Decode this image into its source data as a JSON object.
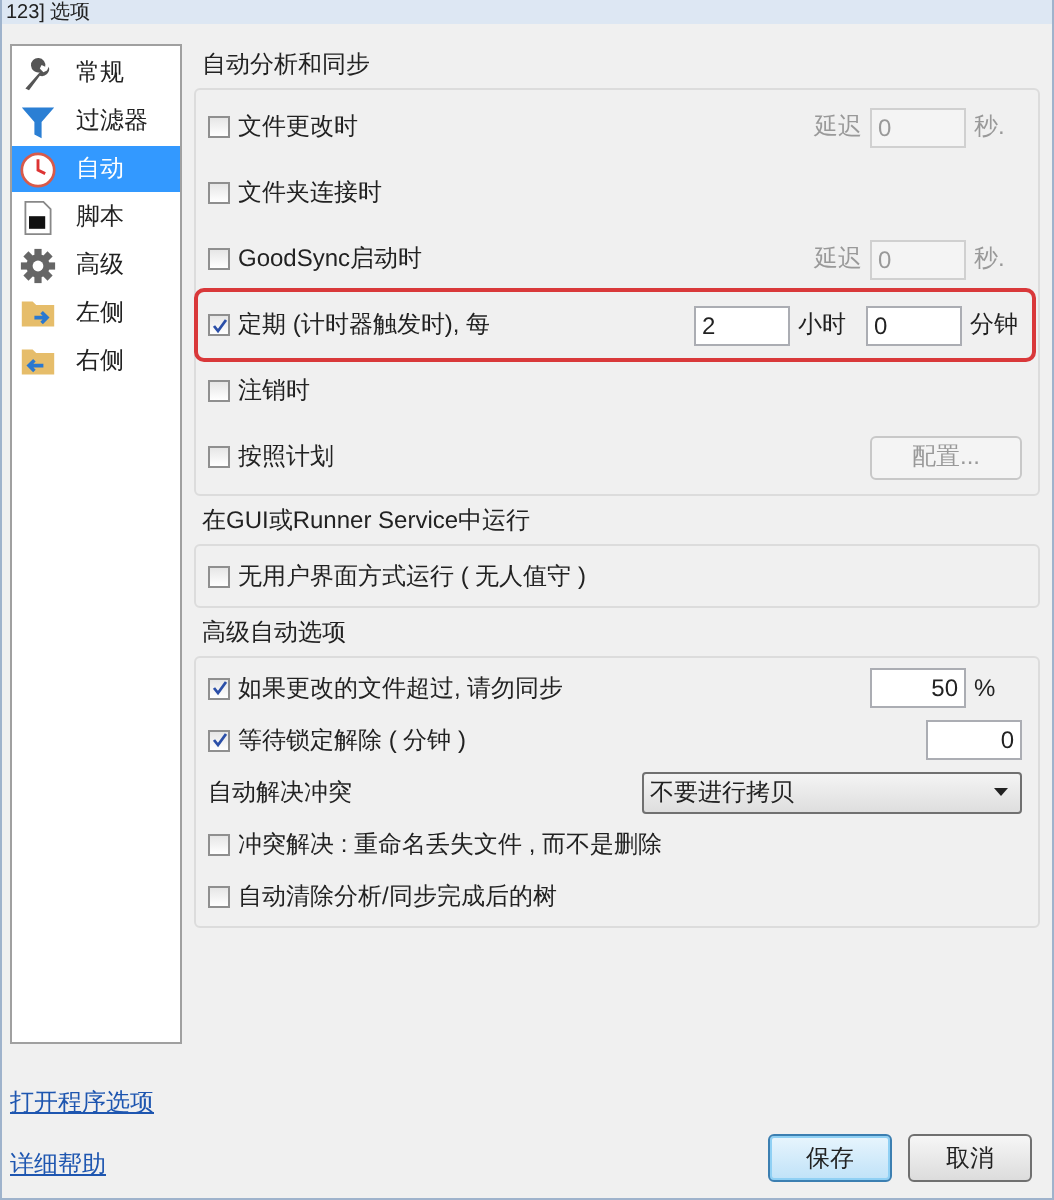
{
  "window": {
    "title": "123] 选项"
  },
  "sidebar": {
    "items": [
      {
        "label": "常规",
        "kind": "wrench",
        "selected": false
      },
      {
        "label": "过滤器",
        "kind": "filter",
        "selected": false
      },
      {
        "label": "自动",
        "kind": "clock",
        "selected": true
      },
      {
        "label": "脚本",
        "kind": "script",
        "selected": false
      },
      {
        "label": "高级",
        "kind": "gear",
        "selected": false
      },
      {
        "label": "左侧",
        "kind": "folder-right",
        "selected": false
      },
      {
        "label": "右侧",
        "kind": "folder-left",
        "selected": false
      }
    ]
  },
  "groups": [
    {
      "title": "自动分析和同步",
      "rows": [
        {
          "kind": "check",
          "label": "文件更改时",
          "checked": false,
          "highlighted": false,
          "fields": [
            {
              "prefix": "延迟",
              "value": "0",
              "suffix": "秒.",
              "disabled": true
            }
          ]
        },
        {
          "kind": "check",
          "label": "文件夹连接时",
          "checked": false,
          "highlighted": false
        },
        {
          "kind": "check",
          "label": "GoodSync启动时",
          "checked": false,
          "highlighted": false,
          "fields": [
            {
              "prefix": "延迟",
              "value": "0",
              "suffix": "秒.",
              "disabled": true
            }
          ]
        },
        {
          "kind": "check",
          "label": "定期 (计时器触发时), 每",
          "checked": true,
          "highlighted": true,
          "fields": [
            {
              "value": "2",
              "suffix": "小时",
              "disabled": false
            },
            {
              "value": "0",
              "suffix": "分钟",
              "disabled": false
            }
          ]
        },
        {
          "kind": "check",
          "label": "注销时",
          "checked": false,
          "highlighted": false
        },
        {
          "kind": "check",
          "label": "按照计划",
          "checked": false,
          "highlighted": false,
          "button": {
            "label": "配置...",
            "disabled": true
          }
        }
      ]
    },
    {
      "title": "在GUI或Runner Service中运行",
      "rows": [
        {
          "kind": "check",
          "label": "无用户界面方式运行 ( 无人值守 )",
          "checked": false,
          "highlighted": false
        }
      ]
    },
    {
      "title": "高级自动选项",
      "rows": [
        {
          "kind": "check",
          "label": "如果更改的文件超过, 请勿同步",
          "checked": true,
          "highlighted": false,
          "fields": [
            {
              "value": "50",
              "suffix": "%",
              "disabled": false
            }
          ]
        },
        {
          "kind": "check",
          "label": "等待锁定解除 ( 分钟 )",
          "checked": true,
          "highlighted": false,
          "fields": [
            {
              "value": "0",
              "disabled": false
            }
          ]
        },
        {
          "kind": "select",
          "label": "自动解决冲突",
          "value": "不要进行拷贝"
        },
        {
          "kind": "check",
          "label": "冲突解决 : 重命名丢失文件 , 而不是删除",
          "checked": false,
          "highlighted": false
        },
        {
          "kind": "check",
          "label": "自动清除分析/同步完成后的树",
          "checked": false,
          "highlighted": false
        }
      ]
    }
  ],
  "links": [
    "打开程序选项",
    "详细帮助"
  ],
  "buttons": [
    {
      "label": "保存",
      "default": true
    },
    {
      "label": "取消",
      "default": false
    }
  ]
}
